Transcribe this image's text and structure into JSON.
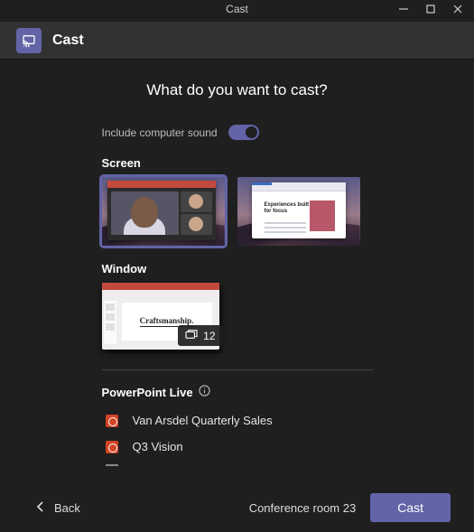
{
  "window": {
    "title": "Cast"
  },
  "header": {
    "app_name": "Cast"
  },
  "main": {
    "prompt": "What do you want to cast?",
    "sound_label": "Include computer sound",
    "groups": {
      "screen_label": "Screen",
      "window_label": "Window"
    },
    "screen2_headline": "Experiences built for focus",
    "window_slide_text": "Craftsmanship.",
    "window_count": "12",
    "pplive": {
      "header": "PowerPoint Live",
      "files": [
        {
          "name": "Van Arsdel Quarterly Sales"
        },
        {
          "name": "Q3 Vision"
        }
      ]
    }
  },
  "footer": {
    "back_label": "Back",
    "room": "Conference room 23",
    "cast_label": "Cast"
  },
  "colors": {
    "accent": "#6264a7",
    "bg": "#201f1f",
    "headerbar": "#333232"
  }
}
